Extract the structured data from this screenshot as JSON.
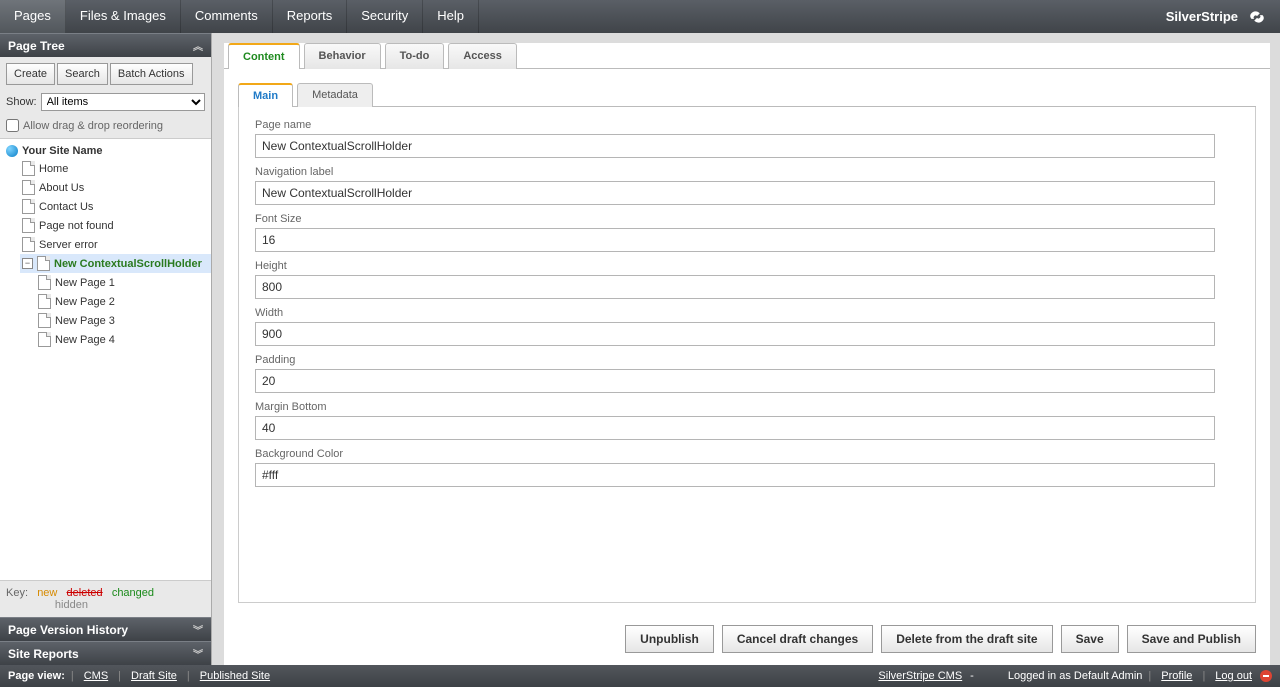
{
  "topMenu": {
    "items": [
      "Pages",
      "Files & Images",
      "Comments",
      "Reports",
      "Security",
      "Help"
    ],
    "activeIndex": 0,
    "brand": "SilverStripe"
  },
  "sidebar": {
    "panelTitle": "Page Tree",
    "buttons": {
      "create": "Create",
      "search": "Search",
      "batch": "Batch Actions"
    },
    "showLabel": "Show:",
    "showValue": "All items",
    "allowReorderLabel": "Allow drag & drop reordering",
    "tree": {
      "rootLabel": "Your Site Name",
      "pages": [
        {
          "label": "Home"
        },
        {
          "label": "About Us"
        },
        {
          "label": "Contact Us"
        },
        {
          "label": "Page not found"
        },
        {
          "label": "Server error"
        }
      ],
      "selected": {
        "label": "New ContextualScrollHolder",
        "children": [
          {
            "label": "New Page 1"
          },
          {
            "label": "New Page 2"
          },
          {
            "label": "New Page 3"
          },
          {
            "label": "New Page 4"
          }
        ]
      }
    },
    "key": {
      "label": "Key:",
      "new": "new",
      "deleted": "deleted",
      "changed": "changed",
      "hidden": "hidden"
    },
    "versionPanel": "Page Version History",
    "reportsPanel": "Site Reports"
  },
  "content": {
    "tabs": [
      "Content",
      "Behavior",
      "To-do",
      "Access"
    ],
    "activeTabIndex": 0,
    "innerTabs": [
      "Main",
      "Metadata"
    ],
    "activeInnerIndex": 0,
    "fields": [
      {
        "label": "Page name",
        "value": "New ContextualScrollHolder"
      },
      {
        "label": "Navigation label",
        "value": "New ContextualScrollHolder"
      },
      {
        "label": "Font Size",
        "value": "16"
      },
      {
        "label": "Height",
        "value": "800"
      },
      {
        "label": "Width",
        "value": "900"
      },
      {
        "label": "Padding",
        "value": "20"
      },
      {
        "label": "Margin Bottom",
        "value": "40"
      },
      {
        "label": "Background Color",
        "value": "#fff"
      }
    ],
    "actions": {
      "unpublish": "Unpublish",
      "cancel": "Cancel draft changes",
      "delete": "Delete from the draft site",
      "save": "Save",
      "savePublish": "Save and Publish"
    }
  },
  "statusbar": {
    "pageViewLabel": "Page view:",
    "links": {
      "cms": "CMS",
      "draft": "Draft Site",
      "published": "Published Site"
    },
    "product": "SilverStripe CMS",
    "dash": "-",
    "loggedInAs": "Logged in as Default Admin",
    "profile": "Profile",
    "logout": "Log out"
  }
}
